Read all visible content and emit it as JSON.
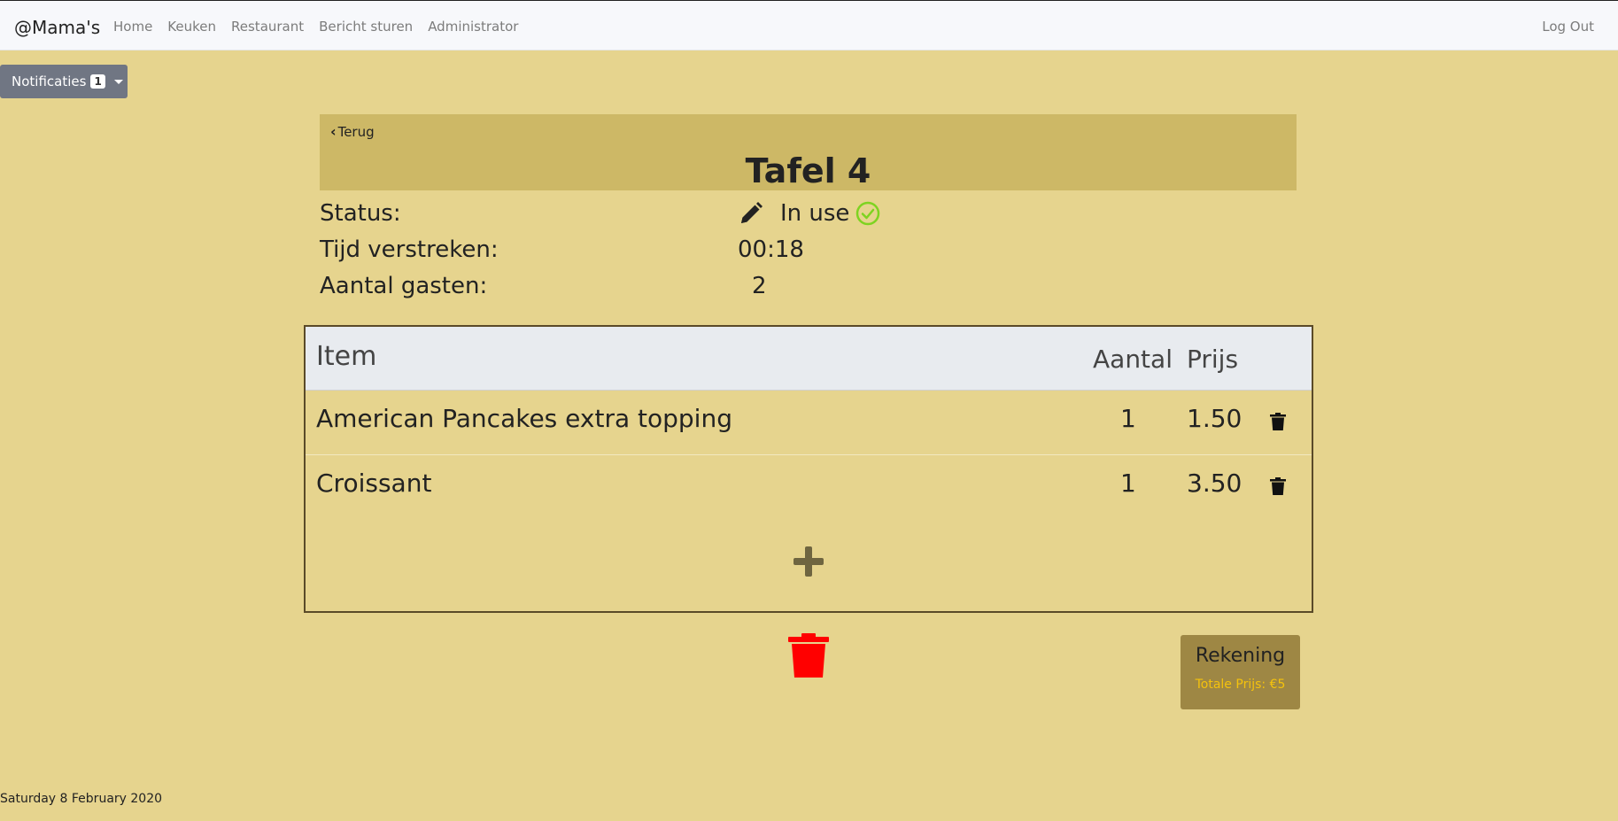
{
  "navbar": {
    "brand": "@Mama's",
    "links": [
      "Home",
      "Keuken",
      "Restaurant",
      "Bericht sturen",
      "Administrator"
    ],
    "logout": "Log Out"
  },
  "notifications": {
    "label": "Notificaties",
    "count": "1"
  },
  "header": {
    "back_label": "Terug",
    "title": "Tafel 4"
  },
  "status": {
    "label": "Status:",
    "value": "In use",
    "check_color": "#7ed321"
  },
  "elapsed": {
    "label": "Tijd verstreken:",
    "value": "00:18"
  },
  "guests": {
    "label": "Aantal gasten:",
    "value": "2"
  },
  "table": {
    "headers": {
      "item": "Item",
      "quantity": "Aantal",
      "price": "Prijs"
    },
    "rows": [
      {
        "item": "American Pancakes extra topping",
        "quantity": "1",
        "price": "1.50"
      },
      {
        "item": "Croissant",
        "quantity": "1",
        "price": "3.50"
      }
    ]
  },
  "bill": {
    "label": "Rekening",
    "total": "Totale Prijs: €5"
  },
  "footer": {
    "date": "Saturday 8 February 2020"
  },
  "colors": {
    "background": "#e6d48e",
    "header_panel": "#cdb866",
    "delete_red": "#ff0000",
    "bill_button": "#9e8744",
    "bill_total_text": "#f4c20d"
  }
}
